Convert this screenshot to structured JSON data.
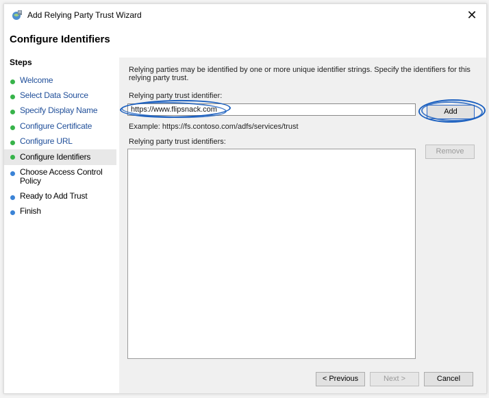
{
  "window": {
    "title": "Add Relying Party Trust Wizard",
    "close_glyph": "✕"
  },
  "page": {
    "heading": "Configure Identifiers"
  },
  "sidebar": {
    "header": "Steps",
    "items": [
      {
        "label": "Welcome",
        "status": "done"
      },
      {
        "label": "Select Data Source",
        "status": "done"
      },
      {
        "label": "Specify Display Name",
        "status": "done"
      },
      {
        "label": "Configure Certificate",
        "status": "done"
      },
      {
        "label": "Configure URL",
        "status": "done"
      },
      {
        "label": "Configure Identifiers",
        "status": "current"
      },
      {
        "label": "Choose Access Control Policy",
        "status": "pending"
      },
      {
        "label": "Ready to Add Trust",
        "status": "pending"
      },
      {
        "label": "Finish",
        "status": "pending"
      }
    ]
  },
  "main": {
    "description": "Relying parties may be identified by one or more unique identifier strings. Specify the identifiers for this relying party trust.",
    "identifier_label": "Relying party trust identifier:",
    "identifier_value": "https://www.flipsnack.com",
    "add_label": "Add",
    "example_text": "Example: https://fs.contoso.com/adfs/services/trust",
    "list_label": "Relying party trust identifiers:",
    "remove_label": "Remove"
  },
  "footer": {
    "previous_label": "< Previous",
    "next_label": "Next >",
    "cancel_label": "Cancel"
  },
  "colors": {
    "done_dot": "#37b34a",
    "pending_dot": "#3b83d6",
    "link_text": "#1f4e99",
    "annotation_ring": "#1a5fbf"
  }
}
